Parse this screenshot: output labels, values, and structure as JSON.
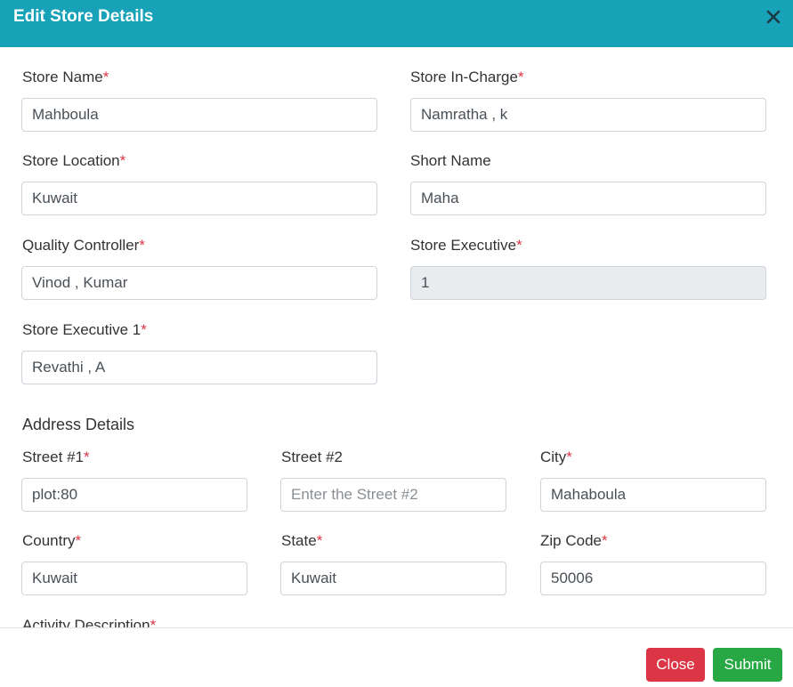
{
  "modal": {
    "title": "Edit Store Details"
  },
  "required_mark": "*",
  "fields": {
    "store_name": {
      "label": "Store Name",
      "value": "Mahboula",
      "required": true
    },
    "store_in_charge": {
      "label": "Store In-Charge",
      "value": "Namratha , k",
      "required": true
    },
    "store_location": {
      "label": "Store Location",
      "value": "Kuwait",
      "required": true
    },
    "short_name": {
      "label": "Short Name",
      "value": "Maha",
      "required": false
    },
    "quality_controller": {
      "label": "Quality Controller",
      "value": "Vinod , Kumar",
      "required": true
    },
    "store_executive": {
      "label": "Store Executive",
      "value": "1",
      "required": true
    },
    "store_executive_1": {
      "label": "Store Executive 1",
      "value": "Revathi , A",
      "required": true
    }
  },
  "address": {
    "title": "Address Details",
    "street1": {
      "label": "Street #1",
      "value": "plot:80"
    },
    "street2": {
      "label": "Street #2",
      "value": "",
      "placeholder": "Enter the Street #2"
    },
    "city": {
      "label": "City",
      "value": "Mahaboula"
    },
    "country": {
      "label": "Country",
      "value": "Kuwait"
    },
    "state": {
      "label": "State",
      "value": "Kuwait"
    },
    "zip": {
      "label": "Zip Code",
      "value": "50006"
    },
    "activity_description": {
      "label": "Activity Description"
    }
  },
  "footer": {
    "close_label": "Close",
    "submit_label": "Submit"
  },
  "colors": {
    "header": "#17a2b8",
    "required": "#dc3545",
    "close_button": "#dc3545",
    "submit_button": "#28a745"
  }
}
